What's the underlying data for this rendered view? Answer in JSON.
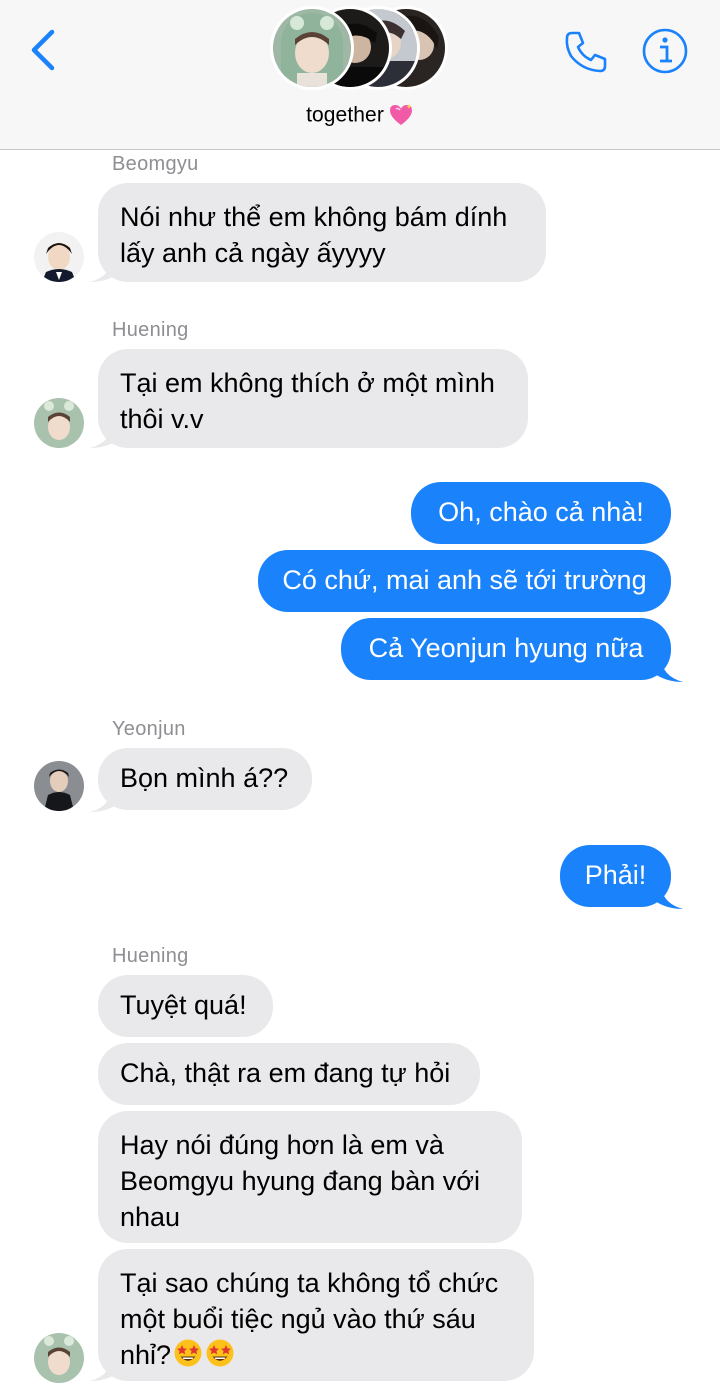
{
  "header": {
    "back_icon": "chevron-left-icon",
    "call_icon": "phone-icon",
    "info_icon": "info-icon",
    "group_name": "together",
    "group_emoji": "sparkling-heart",
    "accent_color": "#1a82fb"
  },
  "messages": [
    {
      "sender": "Beomgyu",
      "direction": "in",
      "lines": [
        "Nói như thể em không bám dính",
        "lấy anh cả ngày ấyyyy"
      ]
    },
    {
      "sender": "Huening",
      "direction": "in",
      "lines": [
        "Tại em không thích ở một mình",
        "thôi v.v"
      ]
    },
    {
      "direction": "out",
      "text": "Oh, chào cả nhà!"
    },
    {
      "direction": "out",
      "text": "Có chứ, mai anh sẽ tới trường"
    },
    {
      "direction": "out",
      "text": "Cả Yeonjun hyung nữa"
    },
    {
      "sender": "Yeonjun",
      "direction": "in",
      "lines": [
        "Bọn mình á??"
      ]
    },
    {
      "direction": "out",
      "text": "Phải!"
    },
    {
      "sender": "Huening",
      "direction": "in",
      "lines": [
        "Tuyệt quá!"
      ]
    },
    {
      "direction": "in",
      "lines": [
        "Chà, thật ra em đang tự hỏi"
      ]
    },
    {
      "direction": "in",
      "lines": [
        "Hay nói đúng hơn là em và",
        "Beomgyu hyung đang bàn với",
        "nhau"
      ]
    },
    {
      "direction": "in",
      "lines": [
        "Tại sao chúng ta không tổ chức",
        "một buổi tiệc ngủ vào thứ sáu",
        "nhỉ?"
      ],
      "emoji": [
        "star-struck",
        "star-struck"
      ]
    }
  ]
}
